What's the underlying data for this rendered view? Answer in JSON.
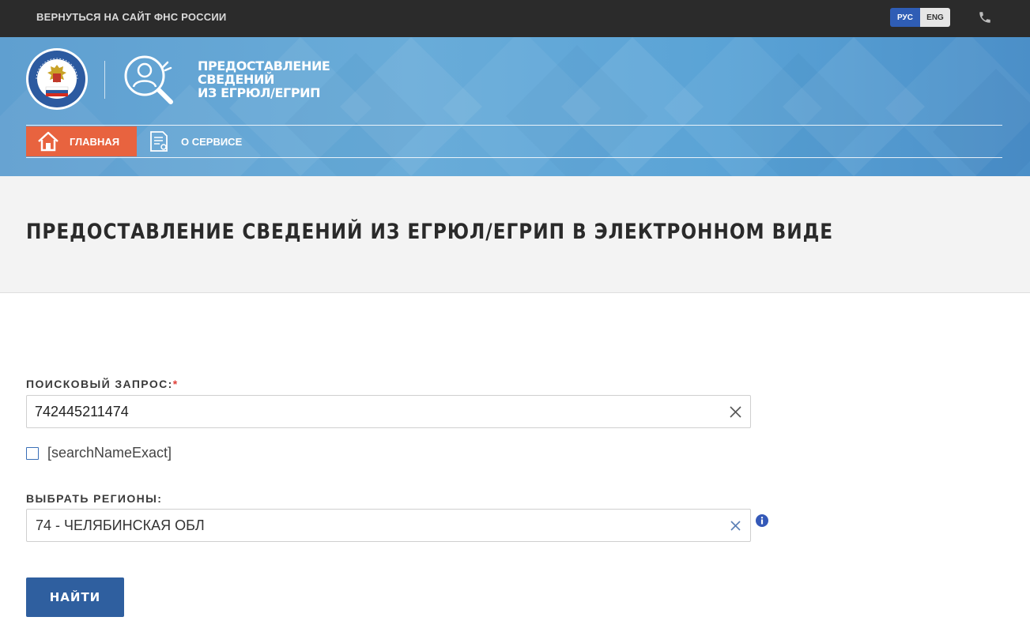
{
  "topbar": {
    "back_link": "ВЕРНУТЬСЯ НА САЙТ ФНС РОССИИ",
    "lang_ru": "РУС",
    "lang_en": "ENG",
    "phone_icon": "phone-icon"
  },
  "header": {
    "emblem_text": "ФЕДЕРАЛЬНАЯ НАЛОГОВАЯ СЛУЖБА",
    "service_title_lines": [
      "ПРЕДОСТАВЛЕНИЕ",
      "СВЕДЕНИЙ",
      "ИЗ ЕГРЮЛ/ЕГРИП"
    ]
  },
  "nav": {
    "items": [
      {
        "label": "ГЛАВНАЯ",
        "icon": "home-icon",
        "active": true
      },
      {
        "label": "О СЕРВИСЕ",
        "icon": "document-icon",
        "active": false
      }
    ]
  },
  "page": {
    "title": "ПРЕДОСТАВЛЕНИЕ СВЕДЕНИЙ ИЗ ЕГРЮЛ/ЕГРИП В ЭЛЕКТРОННОМ ВИДЕ"
  },
  "form": {
    "query_label": "ПОИСКОВЫЙ ЗАПРОС:",
    "query_required_mark": "*",
    "query_value": "742445211474",
    "checkbox_label": "[searchNameExact]",
    "checkbox_checked": false,
    "region_label": "ВЫБРАТЬ РЕГИОНЫ:",
    "region_value": "74 - ЧЕЛЯБИНСКАЯ ОБЛ",
    "submit_label": "НАЙТИ"
  },
  "colors": {
    "topbar": "#2b2b2b",
    "header_blue": "#5fa3d6",
    "nav_active": "#e8633f",
    "lang_active": "#2f5db5",
    "button": "#2f5f9f",
    "required": "#e0413a"
  }
}
